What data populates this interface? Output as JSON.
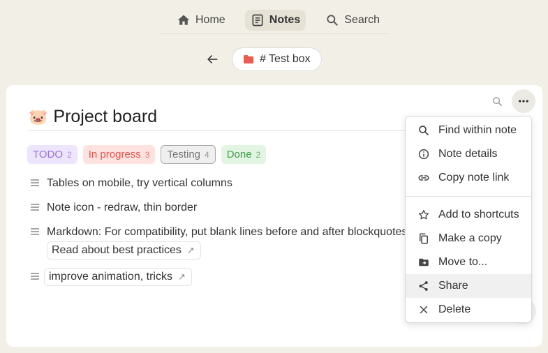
{
  "nav": {
    "home_label": "Home",
    "notes_label": "Notes",
    "search_label": "Search"
  },
  "breadcrumb": {
    "box_label": "# Test box",
    "folder_color": "#e85d4f"
  },
  "note": {
    "emoji": "🐷",
    "title": "Project board",
    "tags": [
      {
        "label": "TODO",
        "count": "2"
      },
      {
        "label": "In progress",
        "count": "3"
      },
      {
        "label": "Testing",
        "count": "4"
      },
      {
        "label": "Done",
        "count": "2"
      }
    ],
    "tasks": [
      {
        "text": "Tables on mobile, try vertical columns"
      },
      {
        "text": "Note icon - redraw, thin border"
      },
      {
        "text": "Markdown: For compatibility, put blank lines before and after blockquotes",
        "link": "Read about best practices"
      },
      {
        "link": "improve animation, tricks"
      }
    ],
    "link_arrow": "↗"
  },
  "menu": {
    "items": [
      {
        "label": "Find within note",
        "icon": "search-icon"
      },
      {
        "label": "Note details",
        "icon": "info-icon"
      },
      {
        "label": "Copy note link",
        "icon": "link-icon"
      },
      {
        "label": "Add to shortcuts",
        "icon": "star-icon"
      },
      {
        "label": "Make a copy",
        "icon": "copy-icon"
      },
      {
        "label": "Move to...",
        "icon": "folder-move-icon"
      },
      {
        "label": "Share",
        "icon": "share-icon"
      },
      {
        "label": "Delete",
        "icon": "close-icon"
      }
    ]
  },
  "colors": {
    "background": "#f2efe6",
    "card": "#ffffff",
    "todo": "#9a72da",
    "in_progress": "#e2564d",
    "testing": "#777777",
    "done": "#3f9e4a"
  }
}
